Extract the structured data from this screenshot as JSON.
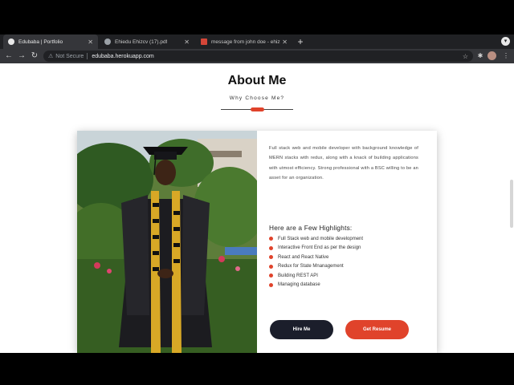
{
  "browser": {
    "tabs": [
      {
        "title": "Edubaba | Portfolio",
        "active": true
      },
      {
        "title": "Ehiedu Ehizcv (17).pdf",
        "active": false
      },
      {
        "title": "message from john doe - ehiz",
        "active": false
      }
    ],
    "address": {
      "security_text": "Not Secure",
      "url": "edubaba.herokuapp.com"
    }
  },
  "about": {
    "title": "About Me",
    "subtitle": "Why Choose Me?",
    "bio": "Full stack web and mobile developer with background knowledge of MERN stacks with redux, along with a knack of building applications with utmost efficiency. Strong professional with a BSC willing to be an asset for an organization.",
    "highlights_title": "Here are a Few Highlights:",
    "highlights": [
      "Full Stack web and mobile development",
      "Interactive Front End as per the design",
      "React and React Native",
      "Redux for State Mnanagement",
      "Building REST API",
      "Managing database"
    ],
    "hire_label": "Hire Me",
    "resume_label": "Get Resume"
  },
  "colors": {
    "accent": "#e0432b",
    "dark_button": "#1b1e2b",
    "chrome_dark": "#202124"
  }
}
